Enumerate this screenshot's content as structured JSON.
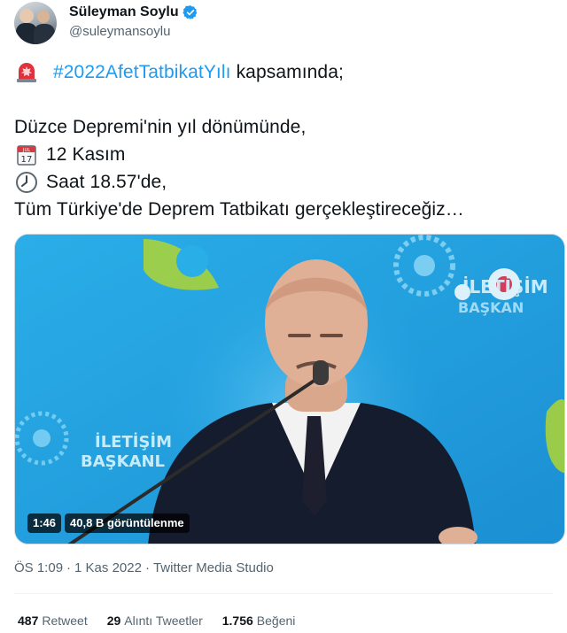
{
  "author": {
    "name": "Süleyman Soylu",
    "handle": "@suleymansoylu"
  },
  "tweet": {
    "line1_hashtag": "#2022AfetTatbikatYılı",
    "line1_rest": "kapsamında;",
    "line2": "Düzce Depremi'nin yıl dönümünde,",
    "line3": "12 Kasım",
    "line4": "Saat 18.57'de,",
    "line5": "Tüm Türkiye'de Deprem Tatbikatı gerçekleştireceğiz…",
    "emoji_line1": "siren-icon",
    "emoji_line3": "calendar-icon",
    "emoji_line4": "clock-icon"
  },
  "media": {
    "duration": "1:46",
    "views": "40,8 B görüntülenme",
    "backdrop_text_1": "İLETİŞİM",
    "backdrop_text_2": "BAŞKANL",
    "backdrop_text_3": "İLETİŞİM",
    "backdrop_text_4": "BAŞKAN"
  },
  "meta": {
    "time": "ÖS 1:09",
    "separator1": "·",
    "date": "1 Kas 2022",
    "separator2": "·",
    "source": "Twitter Media Studio"
  },
  "stats": {
    "retweets_count": "487",
    "retweets_label": "Retweet",
    "quotes_count": "29",
    "quotes_label": "Alıntı Tweetler",
    "likes_count": "1.756",
    "likes_label": "Beğeni"
  },
  "colors": {
    "link": "#1d9bf0",
    "text": "#0f1419",
    "secondary": "#536471",
    "divider": "#eff3f4"
  }
}
